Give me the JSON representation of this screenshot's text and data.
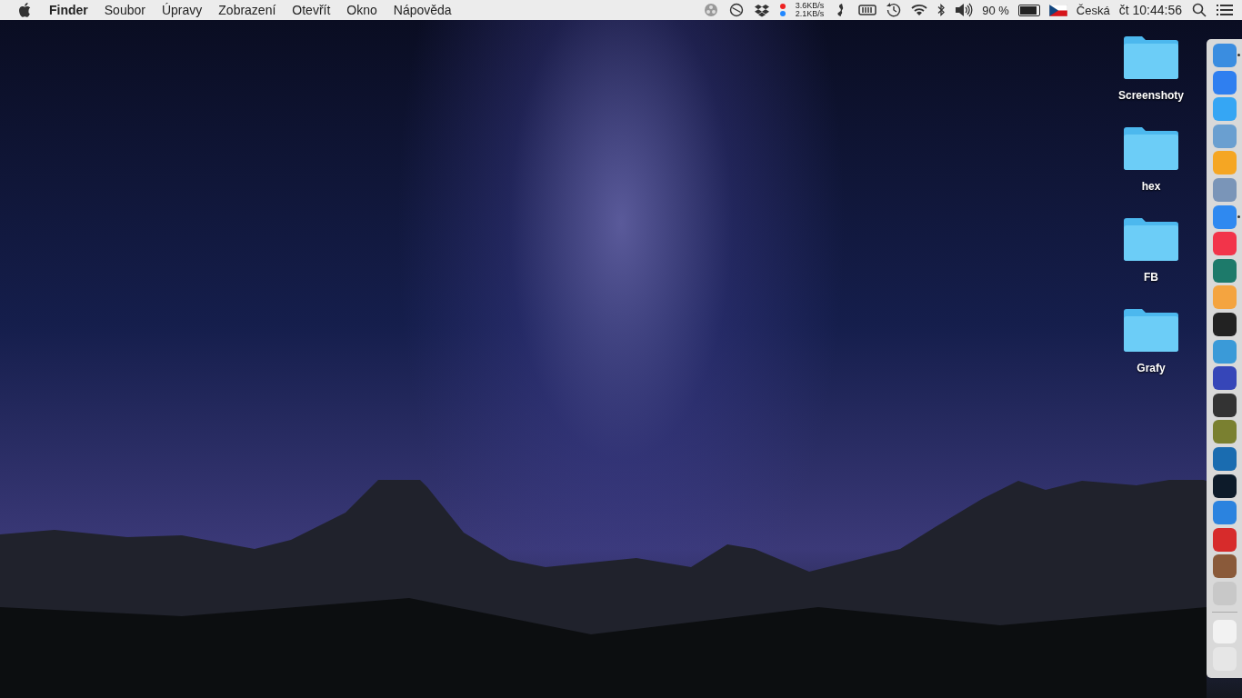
{
  "menubar": {
    "menus": [
      {
        "label": "Finder",
        "kind": "app"
      },
      {
        "label": "Soubor",
        "kind": "menu"
      },
      {
        "label": "Úpravy",
        "kind": "menu"
      },
      {
        "label": "Zobrazení",
        "kind": "menu"
      },
      {
        "label": "Otevřít",
        "kind": "menu"
      },
      {
        "label": "Okno",
        "kind": "menu"
      },
      {
        "label": "Nápověda",
        "kind": "menu"
      }
    ],
    "status": {
      "net_up": "3.6KB/s",
      "net_down": "2.1KB/s",
      "battery_percent": "90 %",
      "battery": {
        "level": 0.9
      },
      "input_source": "Česká",
      "clock": "čt 10:44:56"
    }
  },
  "desktop": {
    "folders": [
      {
        "label": "Screenshoty"
      },
      {
        "label": "hex"
      },
      {
        "label": "FB"
      },
      {
        "label": "Grafy"
      }
    ]
  },
  "dock": {
    "apps": [
      {
        "running": true
      },
      {
        "running": false
      },
      {
        "running": false
      },
      {
        "running": false
      },
      {
        "running": false
      },
      {
        "running": false
      },
      {
        "running": true
      },
      {
        "running": false
      },
      {
        "running": false
      },
      {
        "running": false
      },
      {
        "running": false
      },
      {
        "running": false
      },
      {
        "running": false
      },
      {
        "running": false
      },
      {
        "running": false
      },
      {
        "running": false
      },
      {
        "running": false
      },
      {
        "running": false
      },
      {
        "running": false
      },
      {
        "running": false
      },
      {
        "running": false
      }
    ],
    "documents": [
      {
        "running": false
      },
      {
        "running": false
      }
    ]
  }
}
